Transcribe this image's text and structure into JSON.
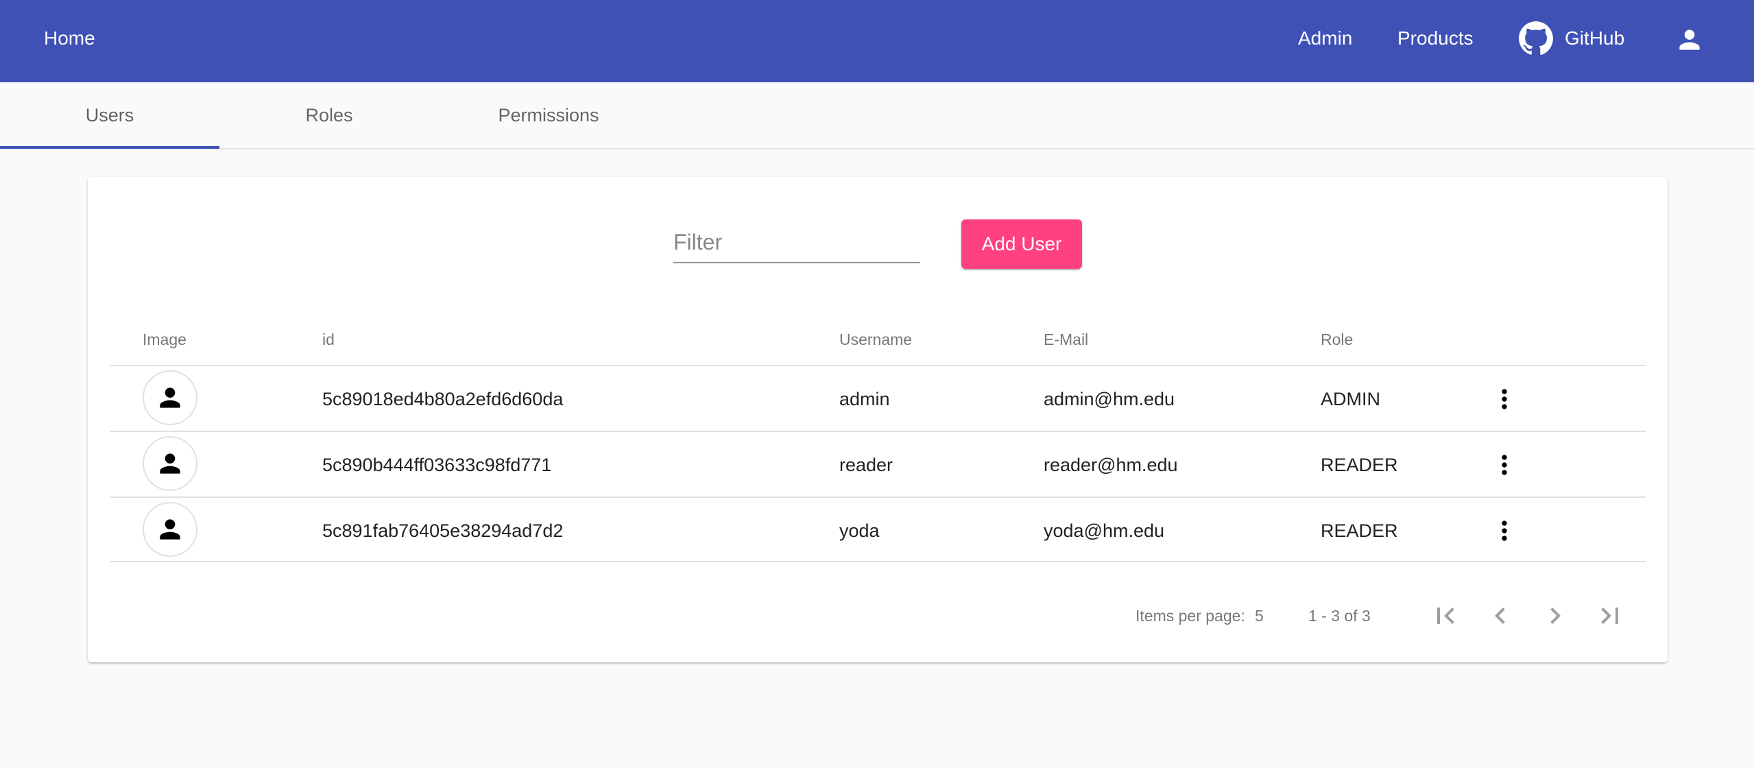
{
  "toolbar": {
    "home": "Home",
    "admin": "Admin",
    "products": "Products",
    "github": "GitHub",
    "account_icon": "account-icon"
  },
  "tabs": [
    "Users",
    "Roles",
    "Permissions"
  ],
  "active_tab": "Users",
  "filter": {
    "placeholder": "Filter",
    "value": ""
  },
  "add_user_label": "Add User",
  "table": {
    "headers": [
      "Image",
      "id",
      "Username",
      "E-Mail",
      "Role"
    ],
    "rows": [
      {
        "id": "5c89018ed4b80a2efd6d60da",
        "username": "admin",
        "email": "admin@hm.edu",
        "role": "ADMIN"
      },
      {
        "id": "5c890b444ff03633c98fd771",
        "username": "reader",
        "email": "reader@hm.edu",
        "role": "READER"
      },
      {
        "id": "5c891fab76405e38294ad7d2",
        "username": "yoda",
        "email": "yoda@hm.edu",
        "role": "READER"
      }
    ]
  },
  "paginator": {
    "items_per_page_label": "Items per page:",
    "page_size": "5",
    "range": "1 - 3 of 3"
  },
  "colors": {
    "primary": "#3f51b5",
    "accent": "#ff4081"
  }
}
